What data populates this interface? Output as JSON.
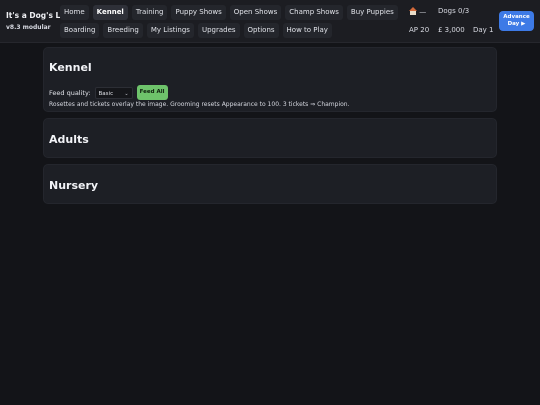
{
  "app": {
    "title": "It's a Dog's Life",
    "version": "v8.3 modular"
  },
  "nav": {
    "row1": [
      {
        "label": "Home",
        "active": false
      },
      {
        "label": "Kennel",
        "active": true
      },
      {
        "label": "Training",
        "active": false
      },
      {
        "label": "Puppy Shows",
        "active": false
      },
      {
        "label": "Open Shows",
        "active": false
      },
      {
        "label": "Champ Shows",
        "active": false
      },
      {
        "label": "Buy Puppies",
        "active": false
      }
    ],
    "row2": [
      {
        "label": "Boarding",
        "active": false
      },
      {
        "label": "Breeding",
        "active": false
      },
      {
        "label": "My Listings",
        "active": false
      },
      {
        "label": "Upgrades",
        "active": false
      },
      {
        "label": "Options",
        "active": false
      },
      {
        "label": "How to Play",
        "active": false
      }
    ]
  },
  "stats": {
    "home_icon": "house-icon",
    "home_value": "—",
    "dogs": "Dogs 0/3",
    "ap": "AP 20",
    "money": "£ 3,000",
    "day": "Day 1"
  },
  "advance": {
    "line1": "Advance",
    "line2": "Day ▶"
  },
  "kennel": {
    "title": "Kennel",
    "feed_label": "Feed quality:",
    "feed_value": "Basic",
    "feed_button": "Feed All",
    "note": "Rosettes and tickets overlay the image. Grooming resets Appearance to 100. 3 tickets ⇒ Champion."
  },
  "adults": {
    "title": "Adults"
  },
  "nursery": {
    "title": "Nursery"
  },
  "colors": {
    "background": "#131418",
    "panel": "#1d1f25",
    "accent": "#3d7ae6",
    "feed_button": "#6ec36b"
  }
}
